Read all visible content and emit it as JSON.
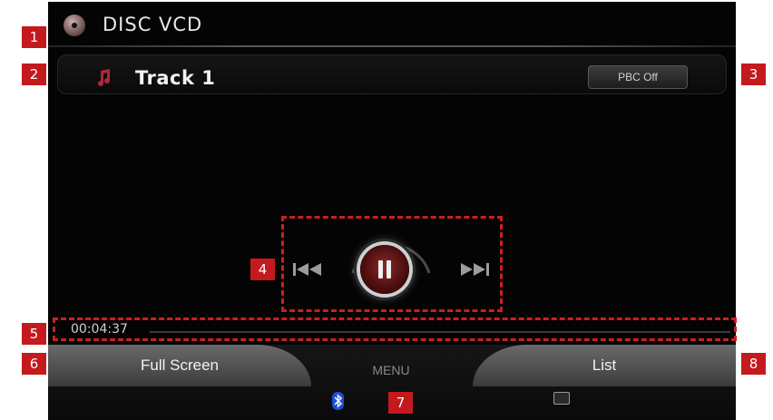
{
  "header": {
    "title": "DISC VCD",
    "icon": "disc-icon"
  },
  "track": {
    "label": "Track 1",
    "icon": "music-note-icon",
    "pbc_button": "PBC Off"
  },
  "controls": {
    "prev_icon": "skip-previous-icon",
    "play_pause_icon": "pause-icon",
    "next_icon": "skip-next-icon"
  },
  "playback": {
    "elapsed_time": "00:04:37"
  },
  "bottom": {
    "full_screen_label": "Full Screen",
    "menu_label": "MENU",
    "list_label": "List",
    "bluetooth_icon": "bluetooth-icon",
    "display_icon": "display-icon"
  },
  "callouts": [
    "1",
    "2",
    "3",
    "4",
    "5",
    "6",
    "7",
    "8"
  ],
  "colors": {
    "callout_red": "#c4191d",
    "screen_bg": "#040404",
    "pause_red": "#8a2a2a"
  }
}
